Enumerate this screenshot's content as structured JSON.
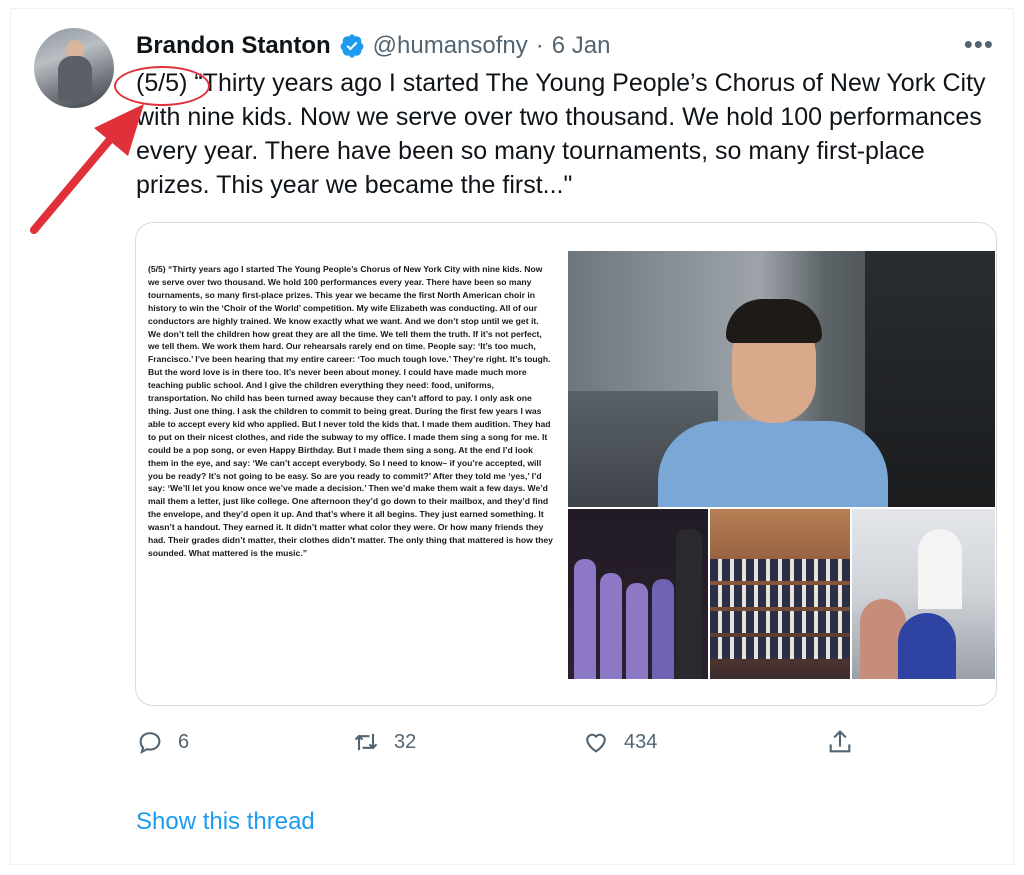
{
  "tweet": {
    "author_name": "Brandon Stanton",
    "handle": "@humansofny",
    "separator": "·",
    "date": "6 Jan",
    "more_glyph": "•••",
    "text": "(5/5) “Thirty years ago I started The Young People’s Chorus of New York City with nine kids. Now we serve over two thousand. We hold 100 performances every year. There have been so many tournaments, so many first-place prizes. This year we became the first...\"",
    "verified_color": "#1d9bf0"
  },
  "card": {
    "caption": "(5/5) “Thirty years ago I started The Young People’s Chorus of New York City with nine kids. Now we serve over two thousand. We hold 100 performances every year. There have been so many tournaments, so many first-place prizes. This year we became the first North American choir in history to win the ‘Choir of the World’ competition. My wife Elizabeth was conducting. All of our conductors are highly trained. We know exactly what we want. And we don’t stop until we get it. We don’t tell the children how great they are all the time. We tell them the truth. If it’s not perfect, we tell them. We work them hard. Our rehearsals rarely end on time. People say: ‘It’s too much, Francisco.’ I’ve been hearing that my entire career: ‘Too much tough love.’ They’re right. It’s tough. But the word love is in there too. It’s never been about money. I could have made much more teaching public school. And I give the children everything they need: food, uniforms, transportation. No child has been turned away because they can’t afford to pay. I only ask one thing. Just one thing. I ask the children to commit to being great. During the first few years I was able to accept every kid who applied. But I never told the kids that. I made them audition. They had to put on their nicest clothes, and ride the subway to my office. I made them sing a song for me. It could be a pop song, or even Happy Birthday. But I made them sing a song. At the end I’d look them in the eye, and say: ‘We can’t accept everybody. So I need to know– if you’re accepted, will you be ready? It’s not going to be easy. So are you ready to commit?’ After they told me ‘yes,’ I’d say: ‘We’ll let you know once we’ve made a decision.’ Then we’d make them wait a few days. We’d mail them a letter, just like college. One afternoon they’d go down to their mailbox, and they’d find the envelope, and they’d open it up. And that’s where it all begins. They just earned something. It wasn’t a handout. They earned it. It didn’t matter what color they were. Or how many friends they had. Their grades didn’t matter, their clothes didn’t matter. The only thing that mattered is how they sounded. What mattered is the music.”"
  },
  "actions": {
    "reply_count": "6",
    "retweet_count": "32",
    "like_count": "434",
    "reply_icon": "reply-icon",
    "retweet_icon": "retweet-icon",
    "like_icon": "like-icon",
    "share_icon": "share-icon"
  },
  "show_thread_label": "Show this thread",
  "colors": {
    "link": "#1d9bf0",
    "secondary_text": "#536471",
    "annotation": "#e0303a"
  }
}
